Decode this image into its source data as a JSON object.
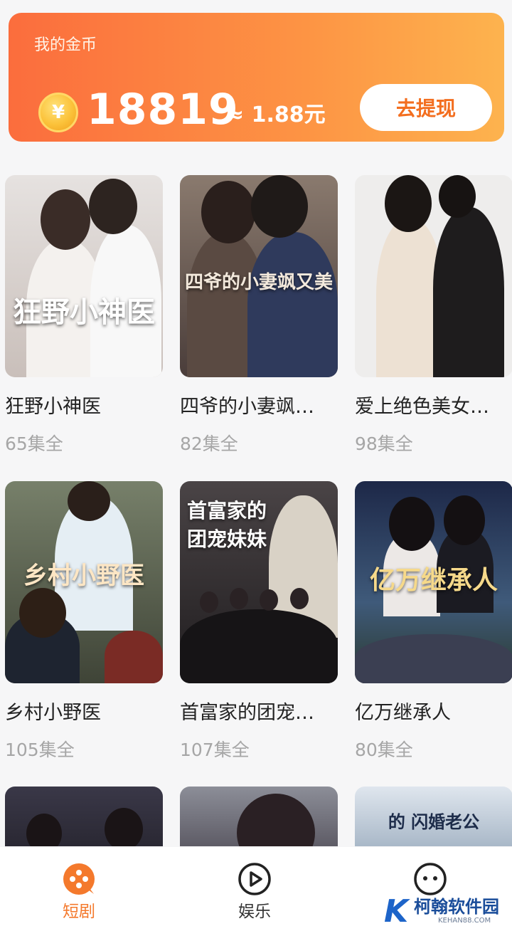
{
  "wallet": {
    "label": "我的金币",
    "coin_symbol": "¥",
    "amount": "18819",
    "approx": "≈ 1.88元",
    "withdraw_label": "去提现"
  },
  "dramas": [
    {
      "title": "狂野小神医",
      "episodes": "65集全",
      "poster_text": "狂野小神医",
      "bg": "#cfc8c4"
    },
    {
      "title": "四爷的小妻飒…",
      "episodes": "82集全",
      "poster_text": "四爷的小妻飒又美",
      "bg": "#6b5a55"
    },
    {
      "title": "爱上绝色美女…",
      "episodes": "98集全",
      "poster_text": "",
      "bg": "#ecebea"
    },
    {
      "title": "乡村小野医",
      "episodes": "105集全",
      "poster_text": "乡村小野医",
      "bg": "#58604a"
    },
    {
      "title": "首富家的团宠…",
      "episodes": "107集全",
      "poster_text": "首富家的团宠妹妹",
      "bg": "#2c2a2c"
    },
    {
      "title": "亿万继承人",
      "episodes": "80集全",
      "poster_text": "亿万继承人",
      "bg": "#2b3a5e"
    }
  ],
  "partial_row": {
    "third_poster_text": "的 闪婚老公"
  },
  "nav": {
    "items": [
      {
        "label": "短剧",
        "icon": "drama-icon",
        "active": true
      },
      {
        "label": "娱乐",
        "icon": "play-icon",
        "active": false
      },
      {
        "label": "",
        "icon": "face-icon",
        "active": false
      }
    ]
  },
  "watermark": {
    "letter": "K",
    "text": "柯翰软件园",
    "sub": "KEHAN88.COM"
  },
  "colors": {
    "accent": "#f4792c",
    "card_gradient_start": "#fb6d3d",
    "card_gradient_end": "#fdb34e"
  }
}
